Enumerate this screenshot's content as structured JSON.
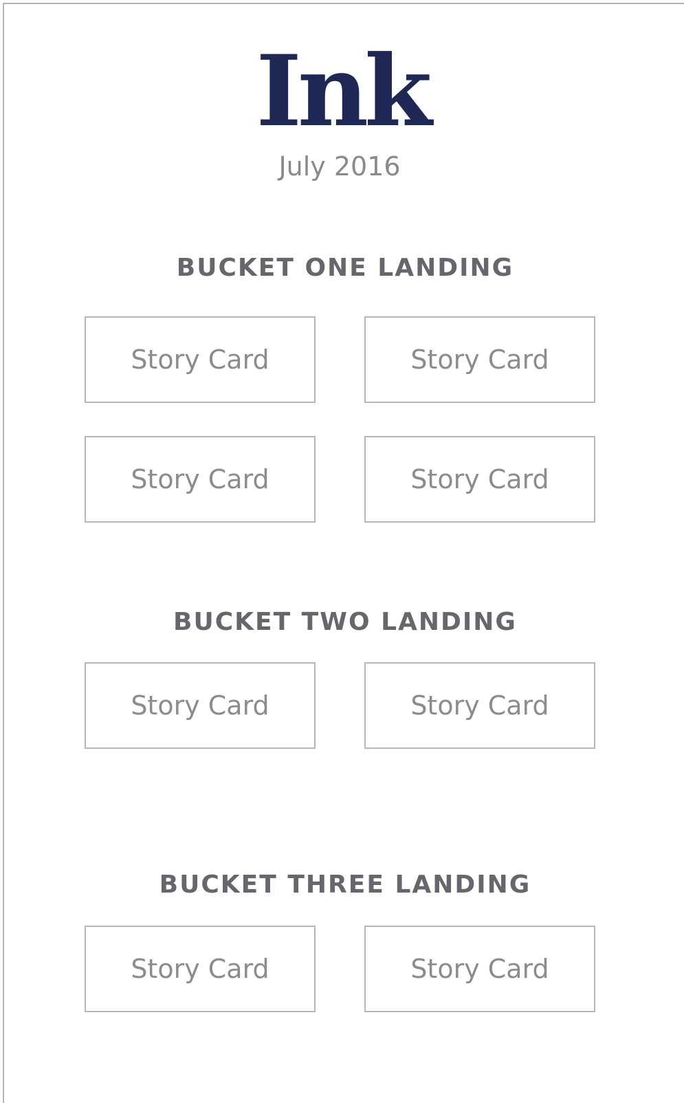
{
  "header": {
    "logo_text": "Ink",
    "date": "July 2016"
  },
  "buckets": [
    {
      "title": "BUCKET ONE LANDING",
      "cards": [
        "Story Card",
        "Story Card",
        "Story Card",
        "Story Card"
      ]
    },
    {
      "title": "BUCKET TWO LANDING",
      "cards": [
        "Story Card",
        "Story Card"
      ]
    },
    {
      "title": "BUCKET THREE LANDING",
      "cards": [
        "Story Card",
        "Story Card"
      ]
    }
  ],
  "colors": {
    "logo": "#1f2855",
    "heading": "#65676c",
    "card_text": "#8c8c8c",
    "card_border": "#b7b7b7"
  }
}
